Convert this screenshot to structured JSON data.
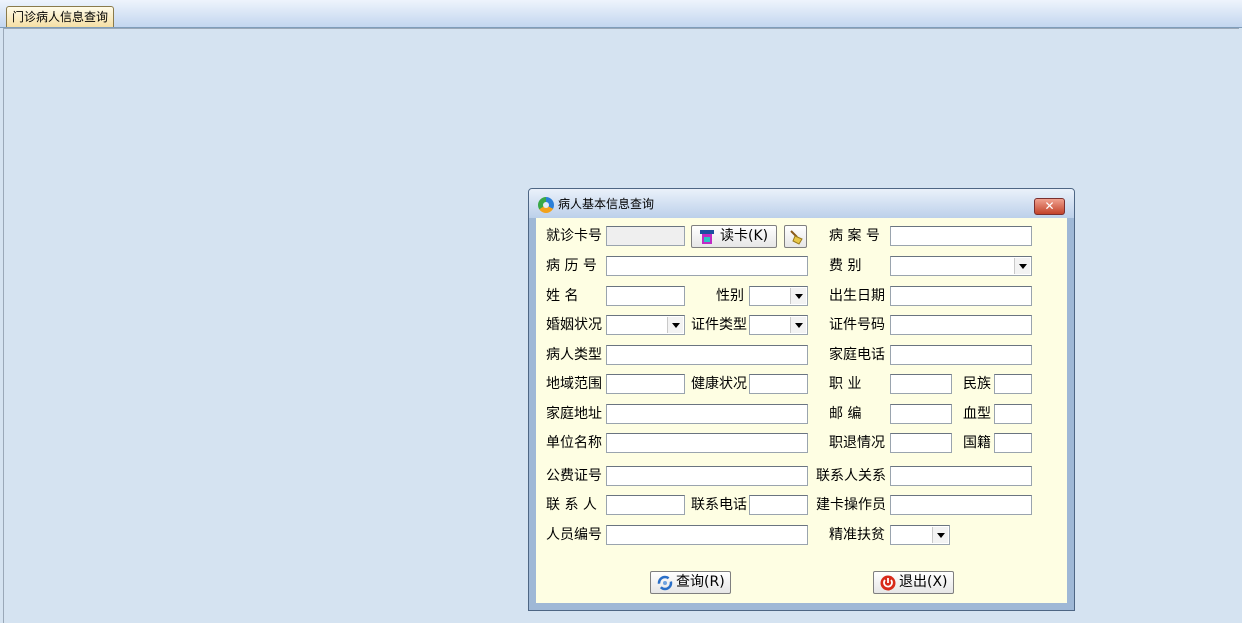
{
  "window": {
    "tab_label": "门诊病人信息查询"
  },
  "dialog": {
    "title": "病人基本信息查询",
    "close_label": "✕",
    "buttons": {
      "read_card": "读卡(K)",
      "query": "查询(R)",
      "exit": "退出(X)"
    },
    "labels": {
      "visit_card_no": "就诊卡号",
      "case_no": "病 案 号",
      "medical_record_no": "病 历 号",
      "fee_type": "费    别",
      "name": "姓    名",
      "gender": "性别",
      "birth_date": "出生日期",
      "marital_status": "婚姻状况",
      "id_type": "证件类型",
      "id_number": "证件号码",
      "patient_type": "病人类型",
      "home_phone": "家庭电话",
      "region": "地域范围",
      "health_status": "健康状况",
      "occupation": "职    业",
      "ethnicity": "民族",
      "home_address": "家庭地址",
      "postcode": "邮    编",
      "blood_type": "血型",
      "work_unit": "单位名称",
      "retirement_status": "职退情况",
      "nationality": "国籍",
      "public_fee_no": "公费证号",
      "contact_relation": "联系人关系",
      "contact_person": "联 系 人",
      "contact_phone": "联系电话",
      "card_operator": "建卡操作员",
      "staff_no": "人员编号",
      "poverty_alleviation": "精准扶贫"
    },
    "icons": {
      "title": "app-logo-icon",
      "read_card": "card-reader-icon",
      "clear": "broom-icon",
      "query": "refresh-icon",
      "exit": "power-icon"
    },
    "colors": {
      "client_bg": "#fefee3",
      "desktop_bg": "#d5e3f1",
      "close_red": "#c2432a"
    }
  }
}
